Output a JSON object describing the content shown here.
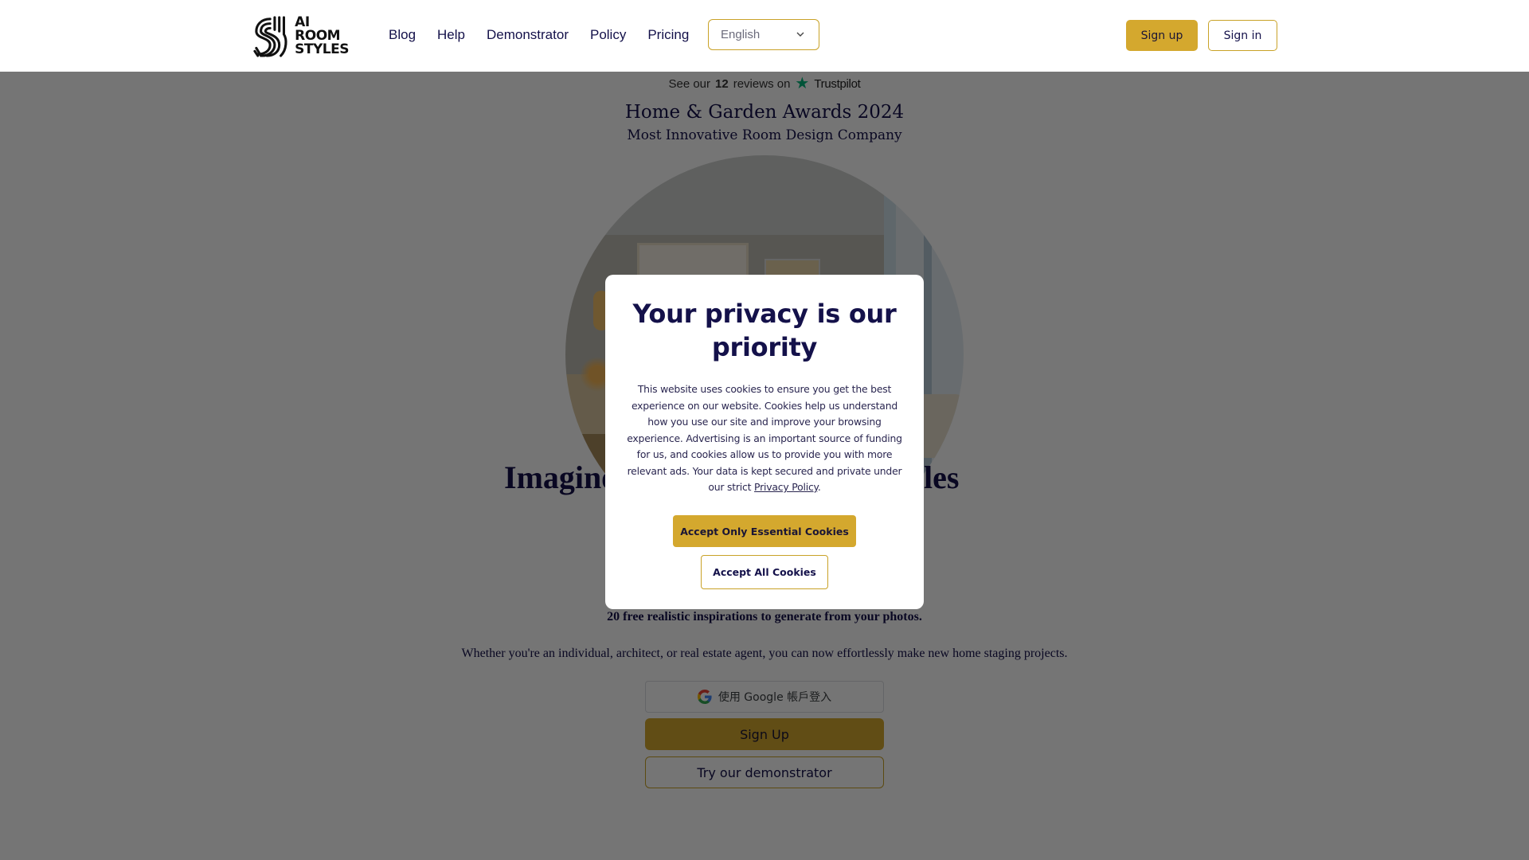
{
  "header": {
    "logo": {
      "lines": [
        "AI",
        "ROOM",
        "STYLES"
      ]
    },
    "nav": [
      {
        "label": "Blog"
      },
      {
        "label": "Help"
      },
      {
        "label": "Demonstrator"
      },
      {
        "label": "Policy"
      },
      {
        "label": "Pricing"
      }
    ],
    "language_select": {
      "value": "English",
      "icon": "chevron-down-icon"
    },
    "sign_up_label": "Sign up",
    "sign_in_label": "Sign in"
  },
  "main": {
    "trustpilot": {
      "prefix": "See our",
      "count": "12",
      "suffix": "reviews on",
      "brand": "Trustpilot",
      "icon": "star-icon"
    },
    "award_title": "Home & Garden Awards 2024",
    "award_subtitle": "Most Innovative Room Design Company",
    "hero_heading_visible_left": "Imagine",
    "hero_heading_visible_right": "yles",
    "hero_subtitle": "20 free realistic inspirations to generate from your photos.",
    "hero_description": "Whether you're an individual, architect, or real estate agent, you can now effortlessly make new home staging projects.",
    "google_button_label": "使用 Google 帳戶登入",
    "sign_up_button_label": "Sign Up",
    "demo_button_label": "Try our demonstrator"
  },
  "cookie_modal": {
    "title": "Your privacy is our priority",
    "body": "This website uses cookies to ensure you get the best experience on our website. Cookies help us understand how you use our site and improve your browsing experience. Advertising is an important source of funding for us, and cookies allow us to provide you with more relevant ads. Your data is kept secured and private under our strict ",
    "link_label": "Privacy Policy",
    "body_end": ".",
    "essential_button_label": "Accept Only Essential Cookies",
    "all_button_label": "Accept All Cookies"
  },
  "colors": {
    "accent_gold": "#d4a82e",
    "navy_text": "#14114a",
    "trustpilot_green": "#00b67a",
    "overlay": "rgba(0,0,0,0.54)"
  }
}
